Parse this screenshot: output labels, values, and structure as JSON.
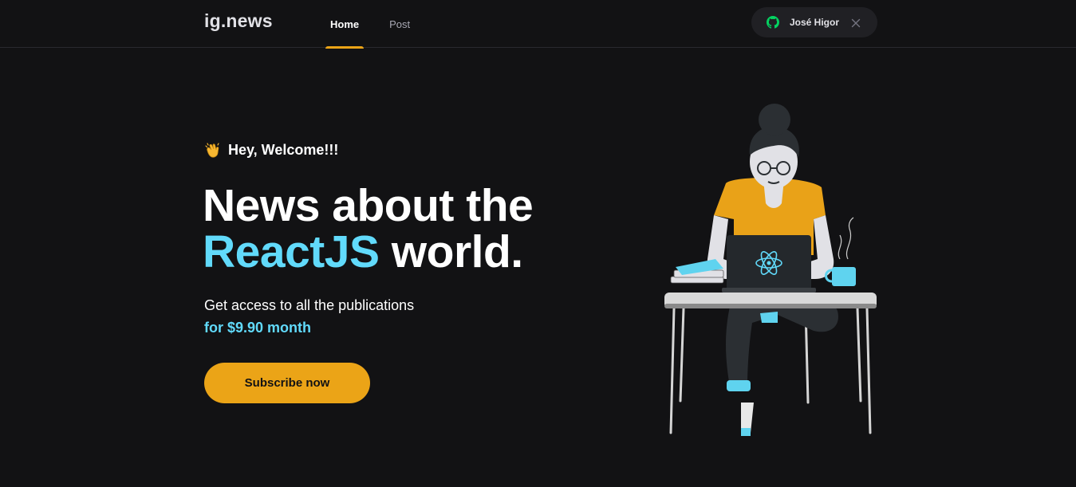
{
  "header": {
    "logo": "ig.news",
    "nav": {
      "home": "Home",
      "post": "Post"
    },
    "user": {
      "name": "José Higor",
      "provider_icon": "github-icon",
      "close_icon": "close-icon"
    }
  },
  "hero": {
    "welcome": "Hey, Welcome!!!",
    "welcome_icon": "clapping-hands-icon",
    "title_line1": "News about the",
    "title_accent": "ReactJS",
    "title_rest": " world.",
    "subtitle": "Get access to all the publications",
    "price": "for $9.90 month",
    "subscribe_label": "Subscribe now"
  },
  "colors": {
    "background": "#121214",
    "accent_yellow": "#eba417",
    "accent_cyan": "#61dafb",
    "github_green": "#04d361"
  }
}
